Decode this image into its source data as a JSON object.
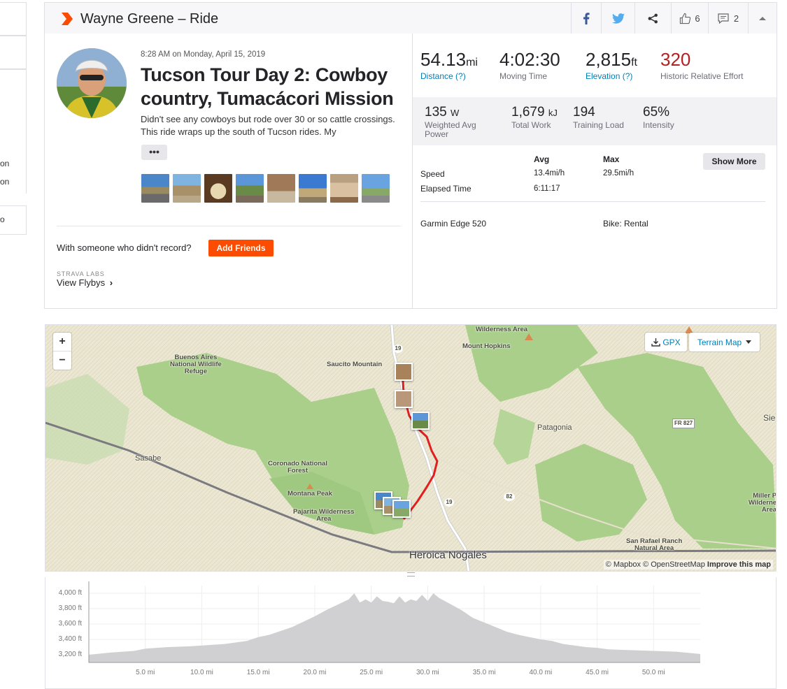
{
  "left_sidebar": {
    "snippets": [
      "on",
      "on",
      "o"
    ]
  },
  "header": {
    "title": "Wayne Greene – Ride",
    "kudos_count": "6",
    "comments_count": "2",
    "facebook_icon": "facebook-icon",
    "twitter_icon": "twitter-icon",
    "share_icon": "share-icon",
    "collapse_icon": "chevron-up-icon",
    "brand_color": "#fc4c02"
  },
  "activity": {
    "datetime": "8:28 AM on Monday, April 15, 2019",
    "title": "Tucson Tour Day 2: Cowboy country, Tumacácori Mission",
    "description": "Didn't see any cowboys but rode over 30 or so cattle crossings. This ride wraps up the south of Tucson rides. My",
    "more_label": "•••",
    "photo_count": 8,
    "with_someone": "With someone who didn't record?",
    "add_friends": "Add Friends",
    "labs_label": "STRAVA LABS",
    "flybys_label": "View Flybys"
  },
  "stats": {
    "distance": {
      "value": "54.13",
      "unit": "mi",
      "label": "Distance (?)"
    },
    "moving_time": {
      "value": "4:02:30",
      "label": "Moving Time"
    },
    "elevation": {
      "value": "2,815",
      "unit": "ft",
      "label": "Elevation (?)"
    },
    "relative_effort": {
      "value": "320",
      "label": "Historic Relative Effort"
    },
    "power": {
      "value": "135",
      "unit": "W",
      "label": "Weighted Avg Power"
    },
    "work": {
      "value": "1,679",
      "unit": "kJ",
      "label": "Total Work"
    },
    "training_load": {
      "value": "194",
      "label": "Training Load"
    },
    "intensity": {
      "value": "65%",
      "label": "Intensity"
    }
  },
  "details": {
    "col_avg": "Avg",
    "col_max": "Max",
    "show_more": "Show More",
    "rows": [
      {
        "label": "Speed",
        "avg": "13.4mi/h",
        "max": "29.5mi/h"
      },
      {
        "label": "Elapsed Time",
        "avg": "6:11:17",
        "max": ""
      }
    ],
    "device": "Garmin Edge 520",
    "bike": "Bike: Rental"
  },
  "map": {
    "zoom_in": "+",
    "zoom_out": "−",
    "gpx_label": "GPX",
    "map_type": "Terrain Map",
    "attribution_mapbox": "© Mapbox",
    "attribution_osm": "© OpenStreetMap",
    "attribution_improve": "Improve this map",
    "route_color": "#e02020",
    "labels": {
      "wilderness": "Wilderness\nArea",
      "mount_hopkins": "Mount Hopkins",
      "buenos_aires": "Buenos Aires\nNational Wildlife\nRefuge",
      "saucito": "Saucito Mountain",
      "patagonia": "Patagonia",
      "sie": "Sie",
      "fr827": "FR 827",
      "sasabe": "Sasabe",
      "coronado": "Coronado National\nForest",
      "montana": "Montana Peak",
      "pajarita": "Pajarita Wilderness\nArea",
      "miller": "Miller P\nWilderne\nArea",
      "san_rafael": "San Rafael Ranch\nNatural Area",
      "nogales": "Heroica Nogales",
      "hwy19a": "19",
      "hwy19b": "19",
      "hwy82": "82"
    }
  },
  "elevation_chart": {
    "y_ticks": [
      "4,000 ft",
      "3,800 ft",
      "3,600 ft",
      "3,400 ft",
      "3,200 ft"
    ],
    "x_ticks": [
      "5.0 mi",
      "10.0 mi",
      "15.0 mi",
      "20.0 mi",
      "25.0 mi",
      "30.0 mi",
      "35.0 mi",
      "40.0 mi",
      "45.0 mi",
      "50.0 mi"
    ]
  },
  "chart_data": {
    "type": "area",
    "title": "",
    "xlabel": "",
    "ylabel": "",
    "xlim": [
      0,
      54.13
    ],
    "ylim": [
      3100,
      4100
    ],
    "x": [
      0,
      2,
      4,
      5,
      7,
      9,
      10,
      12,
      14,
      15,
      16,
      18,
      20,
      21,
      22,
      23,
      23.5,
      24,
      24.5,
      25,
      25.5,
      26,
      26.5,
      27,
      27.5,
      28,
      28.5,
      29,
      29.5,
      30,
      30.5,
      31,
      32,
      33,
      34,
      35,
      36,
      37,
      38,
      39,
      40,
      41,
      42,
      43,
      44,
      45,
      46,
      48,
      50,
      52,
      54.13
    ],
    "y": [
      3200,
      3230,
      3250,
      3280,
      3300,
      3310,
      3320,
      3340,
      3380,
      3430,
      3460,
      3560,
      3700,
      3780,
      3850,
      3920,
      4000,
      3880,
      3920,
      3880,
      3960,
      3900,
      3890,
      3870,
      3960,
      3880,
      3920,
      3900,
      3980,
      3900,
      4000,
      3940,
      3860,
      3780,
      3680,
      3620,
      3560,
      3500,
      3460,
      3430,
      3400,
      3380,
      3340,
      3320,
      3300,
      3290,
      3270,
      3260,
      3250,
      3240,
      3210
    ]
  }
}
